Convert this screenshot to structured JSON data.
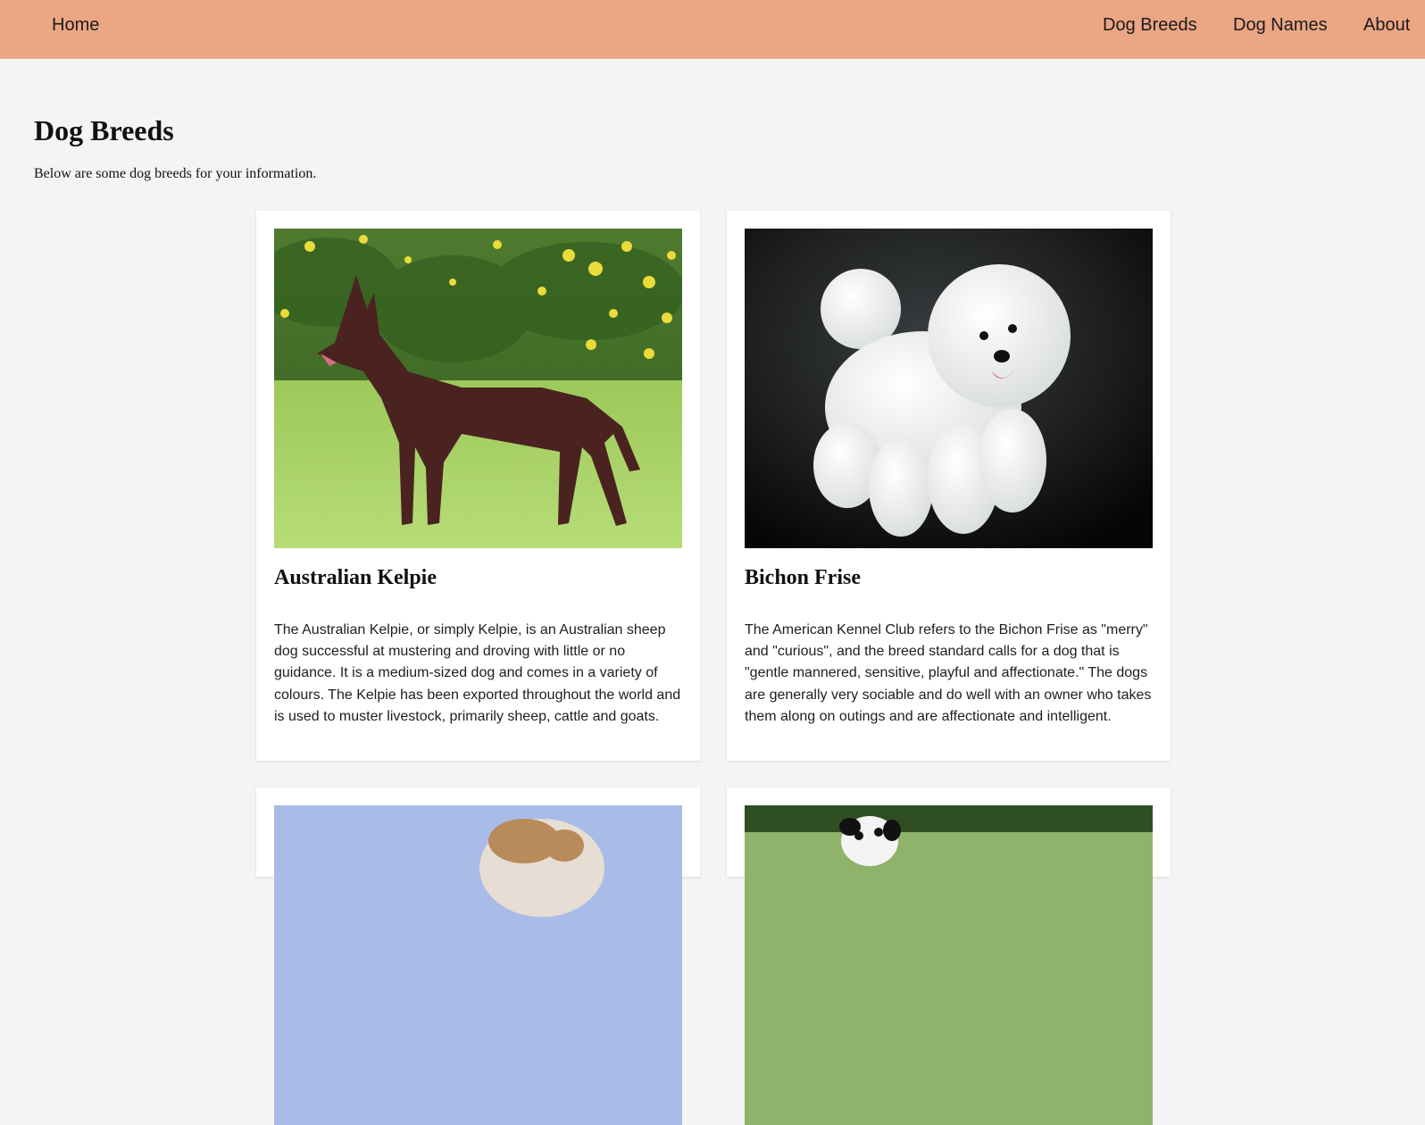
{
  "nav": {
    "home": "Home",
    "breeds": "Dog Breeds",
    "names": "Dog Names",
    "about": "About"
  },
  "page": {
    "title": "Dog Breeds",
    "intro": "Below are some dog breeds for your information."
  },
  "cards": [
    {
      "title": "Australian Kelpie",
      "text": "The Australian Kelpie, or simply Kelpie, is an Australian sheep dog successful at mustering and droving with little or no guidance. It is a medium-sized dog and comes in a variety of colours. The Kelpie has been exported throughout the world and is used to muster livestock, primarily sheep, cattle and goats."
    },
    {
      "title": "Bichon Frise",
      "text": "The American Kennel Club refers to the Bichon Frise as \"merry\" and \"curious\", and the breed standard calls for a dog that is \"gentle mannered, sensitive, playful and affectionate.\" The dogs are generally very sociable and do well with an owner who takes them along on outings and are affectionate and intelligent."
    }
  ],
  "colors": {
    "navbar": "#eba684",
    "background": "#f4f4f4",
    "card": "#ffffff"
  }
}
